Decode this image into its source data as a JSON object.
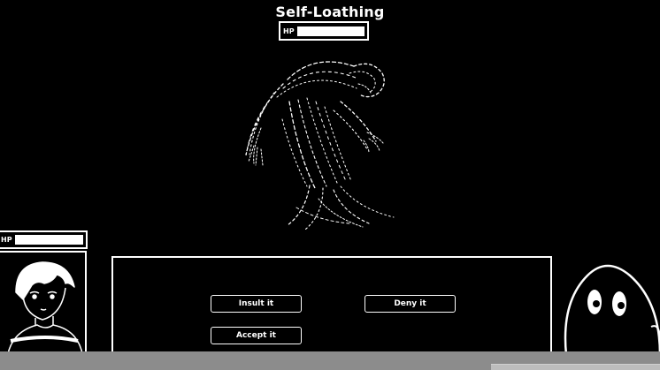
{
  "enemy": {
    "name": "Self-Loathing",
    "hp_label": "HP",
    "hp_fraction": 1.0
  },
  "player": {
    "hp_label": "HP",
    "hp_fraction": 1.0
  },
  "actions": {
    "insult": "Insult it",
    "deny": "Deny it",
    "accept": "Accept it"
  },
  "icons": {
    "monster": "shadow-monster-icon",
    "portrait": "player-portrait-icon",
    "companion": "blob-companion-icon"
  },
  "colors": {
    "background": "#000000",
    "foreground": "#ffffff",
    "bottom_bar": "#8c8c8c"
  }
}
